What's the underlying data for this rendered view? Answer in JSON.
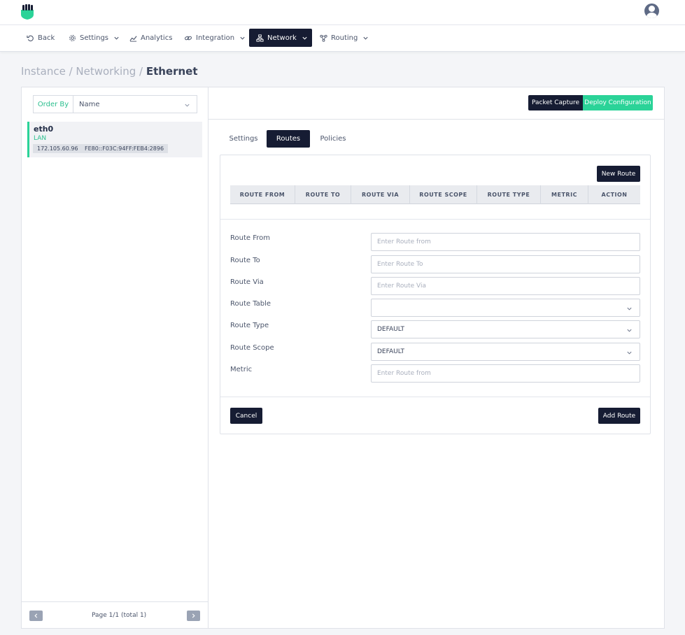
{
  "nav": {
    "back": "Back",
    "settings": "Settings",
    "analytics": "Analytics",
    "integration": "Integration",
    "network": "Network",
    "routing": "Routing"
  },
  "breadcrumb": {
    "part1": "Instance",
    "sep1": " / ",
    "part2": "Networking",
    "sep2": " / ",
    "current": "Ethernet"
  },
  "sidebar": {
    "order_by_label": "Order By",
    "order_by_value": "Name",
    "interfaces": [
      {
        "name": "eth0",
        "type": "LAN",
        "ipv4": "172.105.60.96",
        "ipv6": "FE80::F03C:94FF:FEB4:2896"
      }
    ],
    "pagination": "Page 1/1 (total 1)"
  },
  "header": {
    "packet_capture": "Packet Capture",
    "deploy_configuration": "Deploy Configuration"
  },
  "tabs": [
    {
      "label": "Settings",
      "active": false
    },
    {
      "label": "Routes",
      "active": true
    },
    {
      "label": "Policies",
      "active": false
    }
  ],
  "routes": {
    "new_route_button": "New Route",
    "columns": [
      "ROUTE FROM",
      "ROUTE TO",
      "ROUTE VIA",
      "ROUTE SCOPE",
      "ROUTE TYPE",
      "METRIC",
      "ACTION"
    ]
  },
  "form": {
    "route_from_label": "Route From",
    "route_from_placeholder": "Enter Route from",
    "route_to_label": "Route To",
    "route_to_placeholder": "Enter Route To",
    "route_via_label": "Route Via",
    "route_via_placeholder": "Enter Route Via",
    "route_table_label": "Route Table",
    "route_table_value": "",
    "route_type_label": "Route Type",
    "route_type_value": "DEFAULT",
    "route_scope_label": "Route Scope",
    "route_scope_value": "DEFAULT",
    "metric_label": "Metric",
    "metric_placeholder": "Enter Route from",
    "cancel_button": "Cancel",
    "add_route_button": "Add Route"
  },
  "colors": {
    "primary_dark": "#161c33",
    "accent_green": "#2bd398"
  }
}
